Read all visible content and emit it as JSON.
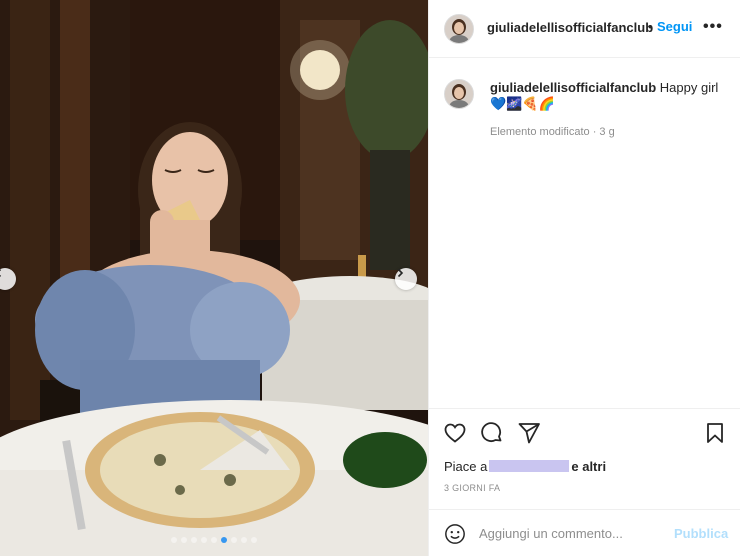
{
  "post": {
    "username": "giuliadelellisofficialfanclub",
    "separator": "•",
    "follow_label": "Segui",
    "more_label": "•••",
    "caption_text": "Happy girl",
    "caption_emojis": "💙🌌🍕🌈",
    "edited_label": "Elemento modificato · 3 g",
    "likes_prefix": "Piace a",
    "likes_suffix": "e altri",
    "time_ago": "3 GIORNI FA",
    "comment_placeholder": "Aggiungi un commento...",
    "publish_label": "Pubblica"
  },
  "carousel": {
    "slide_count": 9,
    "active_index": 5
  },
  "colors": {
    "accent": "#0095f6",
    "publish_disabled": "#b2dffc",
    "active_dot": "#3797f0"
  },
  "icons": {
    "like": "heart-icon",
    "comment": "comment-bubble-icon",
    "share": "paper-plane-icon",
    "save": "bookmark-icon",
    "emoji": "smiley-icon",
    "prev": "chevron-left-icon",
    "next": "chevron-right-icon"
  }
}
